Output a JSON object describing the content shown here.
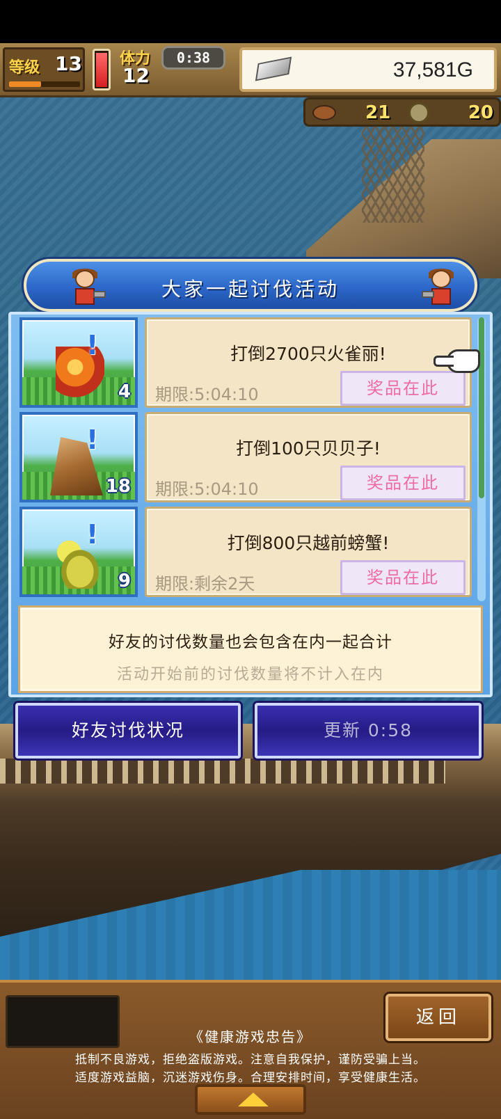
{
  "hud": {
    "level_label": "等级",
    "level_value": "13",
    "level_progress": 0.45,
    "stamina_label": "体力",
    "stamina_value": "12",
    "stamina_fill": 0.9,
    "timer": "0:38",
    "gold": "37,581G",
    "counter_a": "21",
    "counter_b": "20"
  },
  "dialog": {
    "title": "大家一起讨伐活动",
    "missions": [
      {
        "text": "打倒2700只火雀丽!",
        "deadline": "期限:5:04:10",
        "reward_label": "奖品在此",
        "count": "4",
        "monster_icon": "firebird-icon"
      },
      {
        "text": "打倒100只贝贝子!",
        "deadline": "期限:5:04:10",
        "reward_label": "奖品在此",
        "count": "18",
        "monster_icon": "hermit-shell-icon"
      },
      {
        "text": "打倒800只越前螃蟹!",
        "deadline": "期限:剩余2天",
        "reward_label": "奖品在此",
        "count": "9",
        "monster_icon": "crab-icon"
      }
    ],
    "alert_mark": "!",
    "note_main": "好友的讨伐数量也会包含在内一起合计",
    "note_sub": "活动开始前的讨伐数量将不计入在内",
    "friends_button": "好友讨伐状况",
    "refresh_button": "更新 0:58"
  },
  "bottom": {
    "back_button": "返回",
    "advisory_title": "《健康游戏忠告》",
    "advisory_line_1": "抵制不良游戏，拒绝盗版游戏。注意自我保护，谨防受骗上当。",
    "advisory_line_2": "适度游戏益脑，沉迷游戏伤身。合理安排时间，享受健康生活。"
  },
  "colors": {
    "dialog_blue": "#2c67c9",
    "reward_text": "#f06ba2",
    "button_navy": "#251c86",
    "card_beige": "#f3e5c6"
  }
}
